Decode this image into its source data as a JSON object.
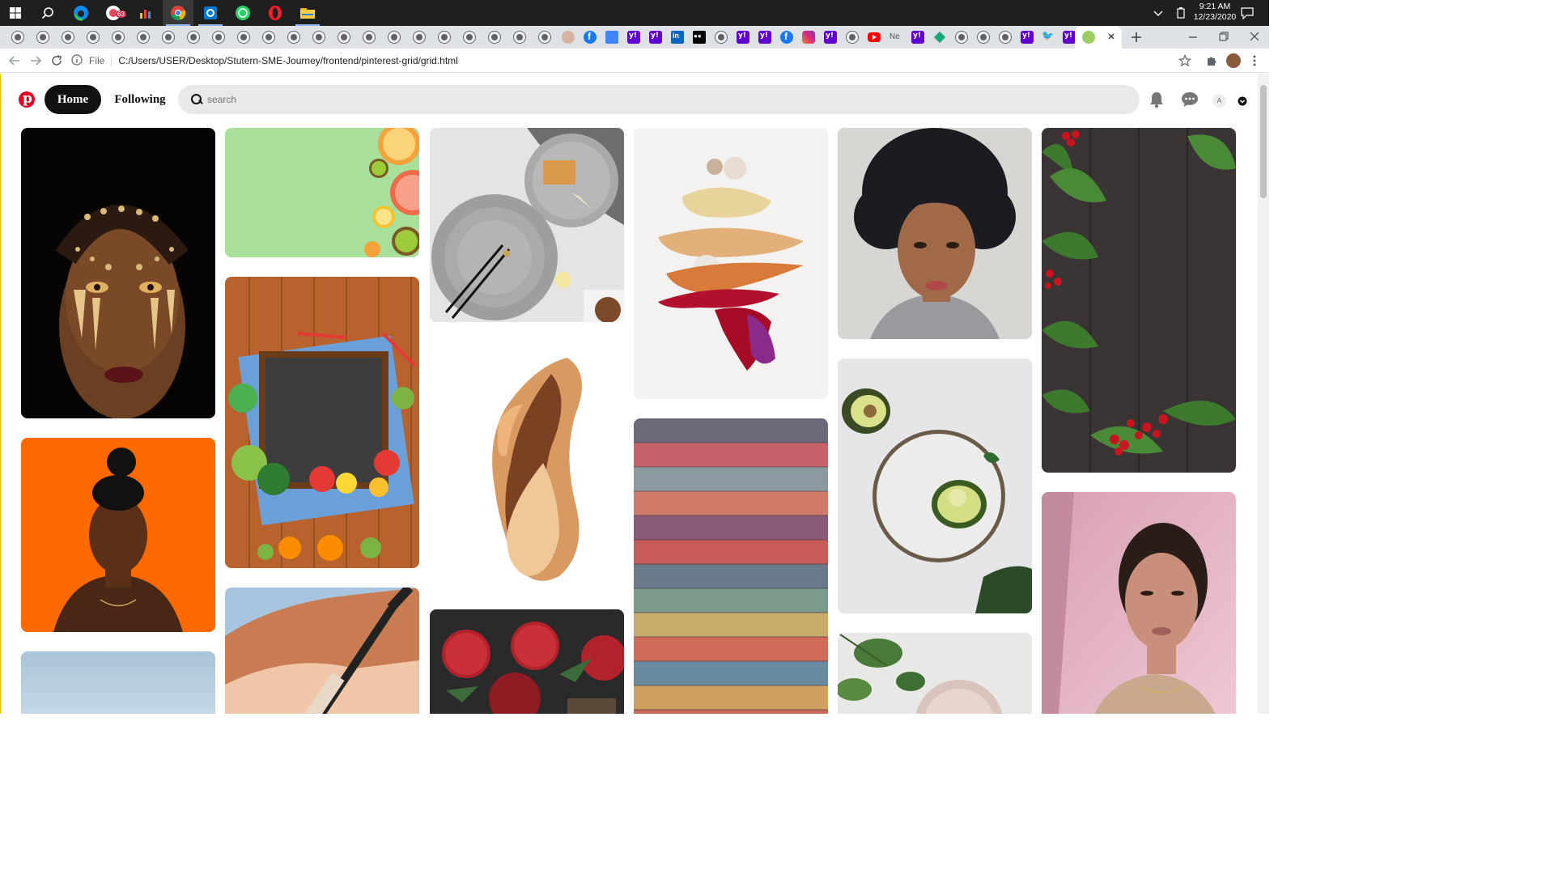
{
  "taskbar": {
    "clock_time": "9:21 AM",
    "clock_date": "12/23/2020",
    "badge_count": "63"
  },
  "browser": {
    "url_scheme": "File",
    "url": "C:/Users/USER/Desktop/Stutern-SME-Journey/frontend/pinterest-grid/grid.html",
    "tab_ne_label": "Ne"
  },
  "header": {
    "home_label": "Home",
    "following_label": "Following",
    "search_placeholder": "search",
    "avatar_initial": "A"
  },
  "colors": {
    "pinterest_red": "#e60023",
    "home_button_bg": "#111111",
    "search_bg": "#e9e9e9"
  },
  "pins": [
    {
      "subject": "face with gold jewel makeup"
    },
    {
      "subject": "woman on orange background"
    },
    {
      "subject": "sky"
    },
    {
      "subject": "citrus fruits on green background"
    },
    {
      "subject": "vegetables chalkboard on wood"
    },
    {
      "subject": "makeup brush on beige"
    },
    {
      "subject": "grey plates with waffle"
    },
    {
      "subject": "foundation swatch"
    },
    {
      "subject": "pomegranates"
    },
    {
      "subject": "cosmetic smears"
    },
    {
      "subject": "rainbow wood planks"
    },
    {
      "subject": "woman with curly hair"
    },
    {
      "subject": "avocado on plate"
    },
    {
      "subject": "leaves and plate"
    },
    {
      "subject": "red berries on dark wood"
    },
    {
      "subject": "woman on pink background"
    }
  ]
}
